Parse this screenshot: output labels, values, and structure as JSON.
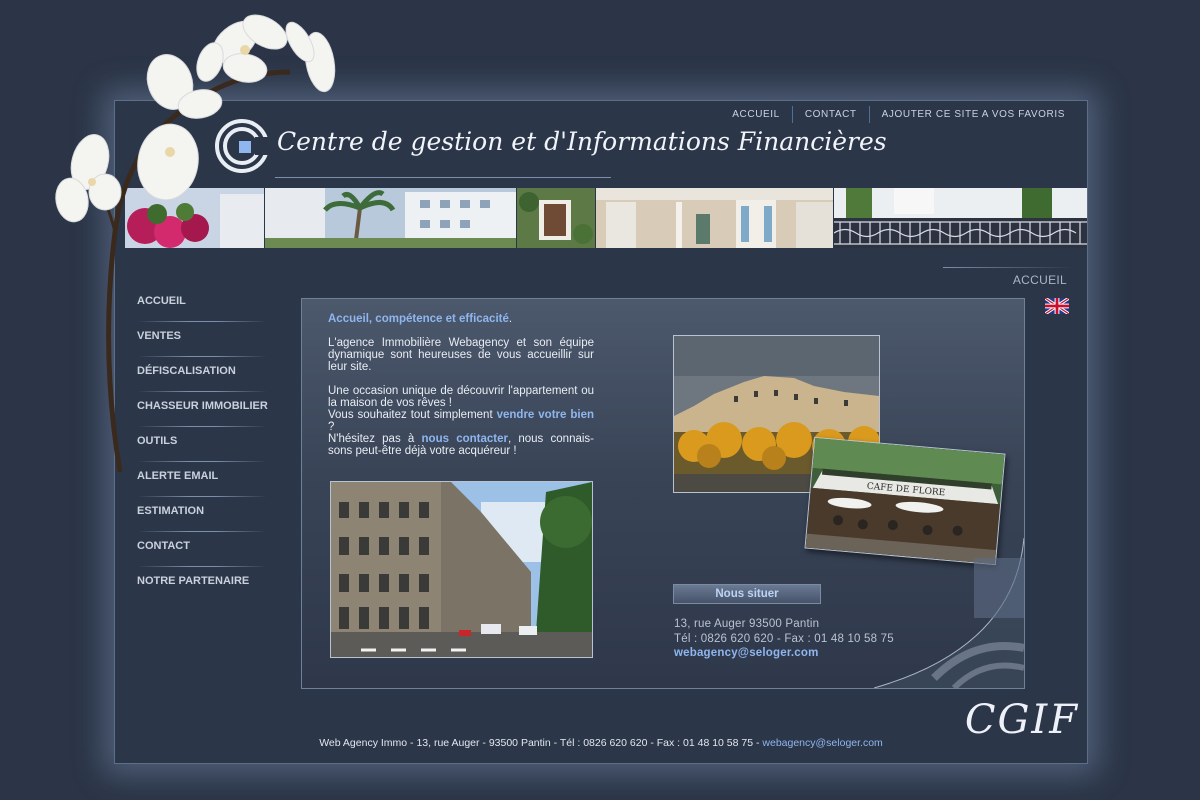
{
  "topnav": [
    {
      "label": "ACCUEIL"
    },
    {
      "label": "CONTACT"
    },
    {
      "label": "AJOUTER CE SITE A VOS FAVORIS"
    }
  ],
  "header": {
    "title": "Centre de gestion et d'Informations Financières"
  },
  "sidebar": {
    "items": [
      {
        "label": "ACCUEIL"
      },
      {
        "label": "VENTES"
      },
      {
        "label": "DÉFISCALISATION"
      },
      {
        "label": "CHASSEUR IMMOBILIER"
      },
      {
        "label": "OUTILS"
      },
      {
        "label": "ALERTE EMAIL"
      },
      {
        "label": "ESTIMATION"
      },
      {
        "label": "CONTACT"
      },
      {
        "label": "NOTRE PARTENAIRE"
      }
    ]
  },
  "breadcrumb": "ACCUEIL",
  "main": {
    "heading": "Accueil, compétence et efficacité",
    "heading_end": ".",
    "p1": "L'agence Immobilière Webagency et son équipe dynamique sont heureuses de vous accueillir sur leur site.",
    "p2_a": "Une occasion unique de découvrir l'appartement ou la maison de vos rêves !",
    "p2_b": "Vous souhaitez tout simplement ",
    "p2_link": "vendre votre bien",
    "p2_c": " ?",
    "p2_d": "N'hésitez pas à ",
    "p2_link2": "nous contacter",
    "p2_e": ", nous connais-sons peut-être déjà votre acquéreur !",
    "cafe_sign": "CAFE DE FLORE"
  },
  "locate": {
    "button": "Nous situer",
    "address": "13, rue Auger 93500 Pantin",
    "phone": "Tél : 0826 620 620 - Fax : 01 48 10 58 75",
    "email": "webagency@seloger.com"
  },
  "footer": {
    "text": "Web Agency Immo - 13, rue Auger - 93500 Pantin - Tél : 0826 620 620 - Fax : 01 48 10 58 75 - ",
    "email": "webagency@seloger.com"
  },
  "signature": "CGIF",
  "colors": {
    "background": "#2b3547",
    "accent": "#8fb6ee",
    "border": "#5d6e88"
  }
}
